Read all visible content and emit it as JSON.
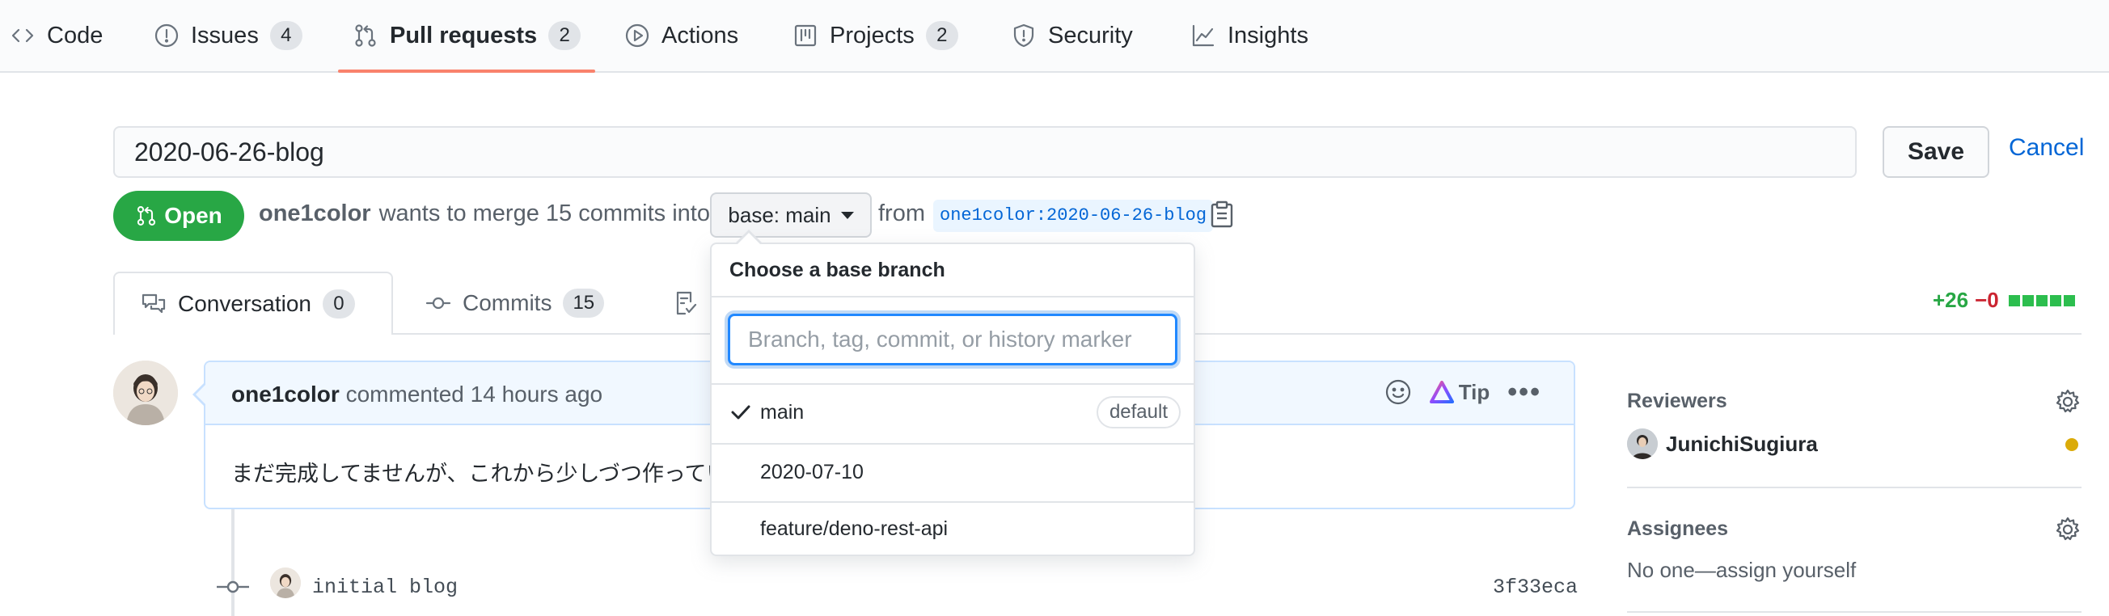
{
  "nav": {
    "tabs": [
      {
        "label": "Code",
        "icon": "code-icon"
      },
      {
        "label": "Issues",
        "count": "4",
        "icon": "issue-icon"
      },
      {
        "label": "Pull requests",
        "count": "2",
        "icon": "pull-request-icon",
        "active": true
      },
      {
        "label": "Actions",
        "icon": "play-icon"
      },
      {
        "label": "Projects",
        "count": "2",
        "icon": "project-icon"
      },
      {
        "label": "Security",
        "icon": "shield-icon"
      },
      {
        "label": "Insights",
        "icon": "graph-icon"
      }
    ]
  },
  "title_edit": {
    "value": "2020-06-26-blog",
    "save_label": "Save",
    "cancel_label": "Cancel"
  },
  "state": {
    "label": "Open",
    "author": "one1color",
    "merge_text": "wants to merge 15 commits into",
    "base_label": "base: main",
    "from_text": "from",
    "head_branch": "one1color:2020-06-26-blog"
  },
  "pr_tabs": [
    {
      "label": "Conversation",
      "count": "0"
    },
    {
      "label": "Commits",
      "count": "15"
    }
  ],
  "diffstat": {
    "additions": "+26",
    "deletions": "−0"
  },
  "comment": {
    "author": "one1color",
    "meta": "commented 14 hours ago",
    "tip_label": "Tip",
    "body": "まだ完成してませんが、これから少しづつ作ってい"
  },
  "timeline": {
    "commit_message": "initial blog",
    "commit_sha": "3f33eca"
  },
  "sidebar": {
    "reviewers_heading": "Reviewers",
    "reviewer_name": "JunichiSugiura",
    "assignees_heading": "Assignees",
    "assignees_empty": "No one—assign yourself"
  },
  "branch_dropdown": {
    "title": "Choose a base branch",
    "placeholder": "Branch, tag, commit, or history marker",
    "items": [
      {
        "label": "main",
        "selected": true,
        "badge": "default"
      },
      {
        "label": "2020-07-10"
      },
      {
        "label": "feature/deno-rest-api"
      }
    ]
  },
  "colors": {
    "accent": "#0366d6",
    "open_green": "#28a745",
    "tab_underline": "#f9826c",
    "pending": "#dbab09"
  }
}
